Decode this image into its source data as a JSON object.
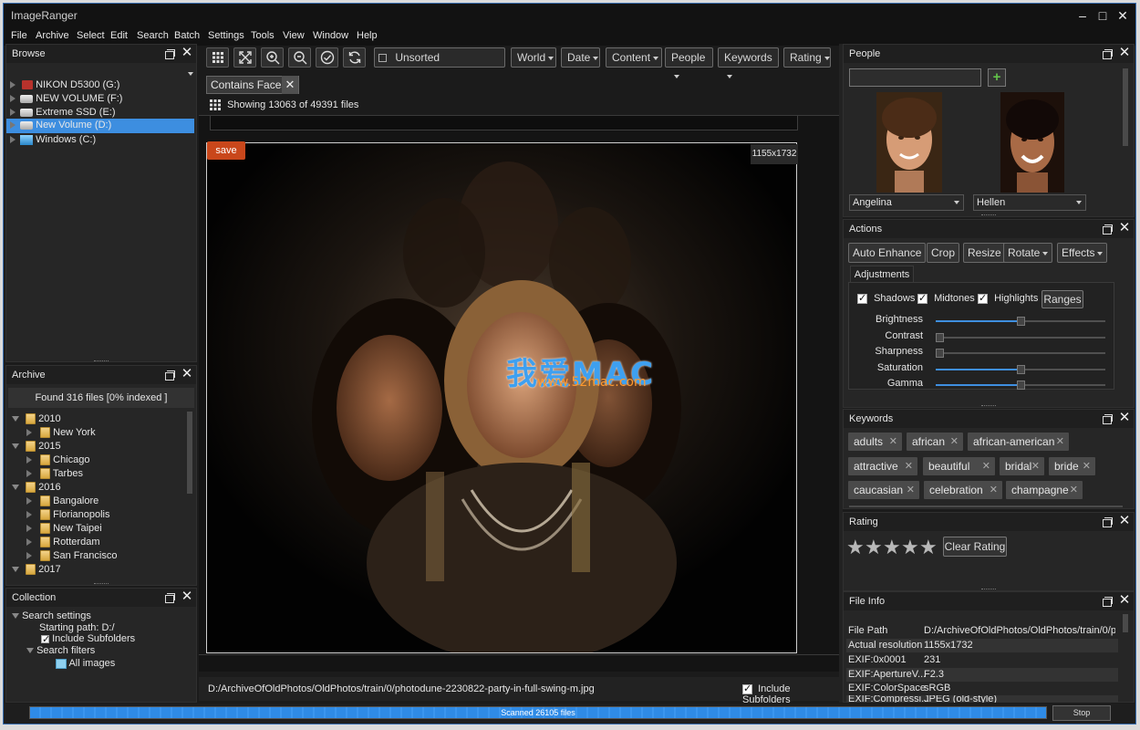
{
  "app": {
    "title": "ImageRanger"
  },
  "menu": [
    "File",
    "Archive",
    "Select",
    "Edit",
    "Search",
    "Batch",
    "Settings",
    "Tools",
    "View",
    "Window",
    "Help"
  ],
  "browse": {
    "title": "Browse",
    "drives": [
      {
        "label": "NIKON D5300 (G:)",
        "icon": "camera-drive-icon"
      },
      {
        "label": "NEW VOLUME (F:)",
        "icon": "drive-icon"
      },
      {
        "label": "Extreme SSD (E:)",
        "icon": "drive-icon"
      },
      {
        "label": "New Volume (D:)",
        "icon": "drive-icon",
        "selected": true
      },
      {
        "label": "Windows (C:)",
        "icon": "windows-drive-icon"
      }
    ]
  },
  "archive": {
    "title": "Archive",
    "status": "Found 316 files [0% indexed ]",
    "tree": [
      {
        "label": "2010",
        "level": 0,
        "expanded": true
      },
      {
        "label": "New York",
        "level": 1
      },
      {
        "label": "2015",
        "level": 0,
        "expanded": true
      },
      {
        "label": "Chicago",
        "level": 1
      },
      {
        "label": "Tarbes",
        "level": 1
      },
      {
        "label": "2016",
        "level": 0,
        "expanded": true
      },
      {
        "label": "Bangalore",
        "level": 1
      },
      {
        "label": "Florianopolis",
        "level": 1
      },
      {
        "label": "New Taipei",
        "level": 1
      },
      {
        "label": "Rotterdam",
        "level": 1
      },
      {
        "label": "San Francisco",
        "level": 1
      },
      {
        "label": "2017",
        "level": 0,
        "expanded": true
      }
    ]
  },
  "collection": {
    "title": "Collection",
    "search_settings": "Search settings",
    "starting_path": "Starting path: D:/",
    "include_subfolders": "Include Subfolders",
    "search_filters": "Search filters",
    "all_images": "All images"
  },
  "toolbar": {
    "sort_value": "Unsorted",
    "filters": [
      "World",
      "Date",
      "Content",
      "People",
      "Keywords",
      "Rating"
    ],
    "icons": [
      "grid-view-icon",
      "fit-screen-icon",
      "zoom-in-icon",
      "zoom-out-icon",
      "check-icon",
      "refresh-icon"
    ]
  },
  "filter_chip": {
    "label": "Contains Faces"
  },
  "status": {
    "showing": "Showing 13063 of 49391 files"
  },
  "viewer": {
    "save_label": "save",
    "resolution": "1155x1732",
    "watermark_line1": "我爱MAC",
    "watermark_line2": "www.52mac.com",
    "file_path": "D:/ArchiveOfOldPhotos/OldPhotos/train/0/photodune-2230822-party-in-full-swing-m.jpg",
    "include_subfolders": "Include Subfolders"
  },
  "people": {
    "title": "People",
    "search_value": "",
    "persons": [
      {
        "name": "Angelina"
      },
      {
        "name": "Hellen"
      }
    ]
  },
  "actions": {
    "title": "Actions",
    "buttons": [
      "Auto Enhance",
      "Crop",
      "Resize",
      "Rotate",
      "Effects"
    ],
    "tab": "Adjustments",
    "checks": [
      {
        "label": "Shadows",
        "checked": true
      },
      {
        "label": "Midtones",
        "checked": true
      },
      {
        "label": "Highlights",
        "checked": true
      }
    ],
    "ranges_label": "Ranges",
    "sliders": [
      {
        "label": "Brightness",
        "value": 0.5
      },
      {
        "label": "Contrast",
        "value": 0.0
      },
      {
        "label": "Sharpness",
        "value": 0.0
      },
      {
        "label": "Saturation",
        "value": 0.5
      },
      {
        "label": "Gamma",
        "value": 0.5
      }
    ]
  },
  "keywords": {
    "title": "Keywords",
    "items": [
      "adults",
      "african",
      "african-american",
      "attractive",
      "beautiful",
      "bridal",
      "bride",
      "caucasian",
      "celebration",
      "champagne"
    ]
  },
  "rating": {
    "title": "Rating",
    "value": 0,
    "max": 5,
    "clear_label": "Clear Rating"
  },
  "file_info": {
    "title": "File Info",
    "rows": [
      {
        "key": "File Path",
        "value": "D:/ArchiveOfOldPhotos/OldPhotos/train/0/p..."
      },
      {
        "key": "Actual resolution",
        "value": "1155x1732"
      },
      {
        "key": "EXIF:0x0001",
        "value": "231"
      },
      {
        "key": "EXIF:ApertureV...",
        "value": "F2.3"
      },
      {
        "key": "EXIF:ColorSpace",
        "value": "sRGB"
      },
      {
        "key": "EXIF:Compressi...",
        "value": "JPEG (old-style)"
      }
    ]
  },
  "bottom": {
    "progress_label": "Scanned 26105 files",
    "progress": 1.0,
    "stop_label": "Stop"
  },
  "colors": {
    "accent": "#2f8be6",
    "selection": "#3d8ee0",
    "save": "#c9471b"
  }
}
